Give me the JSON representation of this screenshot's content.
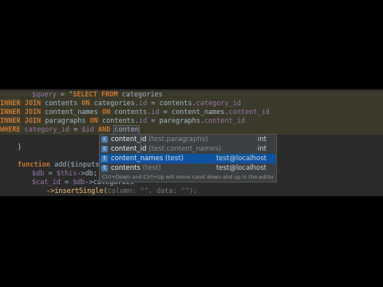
{
  "lines": [
    {
      "parts": [
        "$query",
        " = \"",
        "SELECT FROM",
        " categories"
      ]
    },
    {
      "parts": [
        "INNER JOIN",
        " contents ",
        "ON",
        " categories.",
        "id",
        " = contents.",
        "category_id"
      ]
    },
    {
      "parts": [
        "INNER JOIN",
        " content_names ",
        "ON",
        " contents.",
        "id",
        " = content_names.",
        "content_id"
      ]
    },
    {
      "parts": [
        "INNER JOIN",
        " paragraphs ",
        "ON",
        " contents.",
        "id",
        " = paregraphs.",
        "content_id"
      ]
    },
    {
      "parts": [
        "WHERE",
        " category_id",
        " = ",
        "$id",
        " AND ",
        "conten"
      ]
    },
    {
      "parts": [
        "}"
      ]
    },
    {
      "parts": [
        "function",
        " add($inputs,"
      ]
    },
    {
      "parts": [
        "$db",
        " = ",
        "$this",
        "->db;"
      ]
    },
    {
      "parts": [
        "$cat_id",
        " = ",
        "$db",
        "->categories"
      ]
    },
    {
      "parts": [
        "->insertSingle(",
        "column:",
        " \"\", ",
        "data:",
        " \"\");"
      ]
    }
  ],
  "completion": {
    "items": [
      {
        "icon": "c",
        "name": "content_id",
        "context": "(test.paragraphs)",
        "type": "int"
      },
      {
        "icon": "c",
        "name": "content_id",
        "context": "(test.content_names)",
        "type": "int"
      },
      {
        "icon": "t",
        "name": "content_names",
        "context": "(test)",
        "type": "test@localhost",
        "selected": true
      },
      {
        "icon": "t",
        "name": "contents",
        "context": "(test)",
        "type": "test@localhost"
      }
    ],
    "footer": "Ctrl+Down and Ctrl+Up will move caret down and up in the editor"
  }
}
